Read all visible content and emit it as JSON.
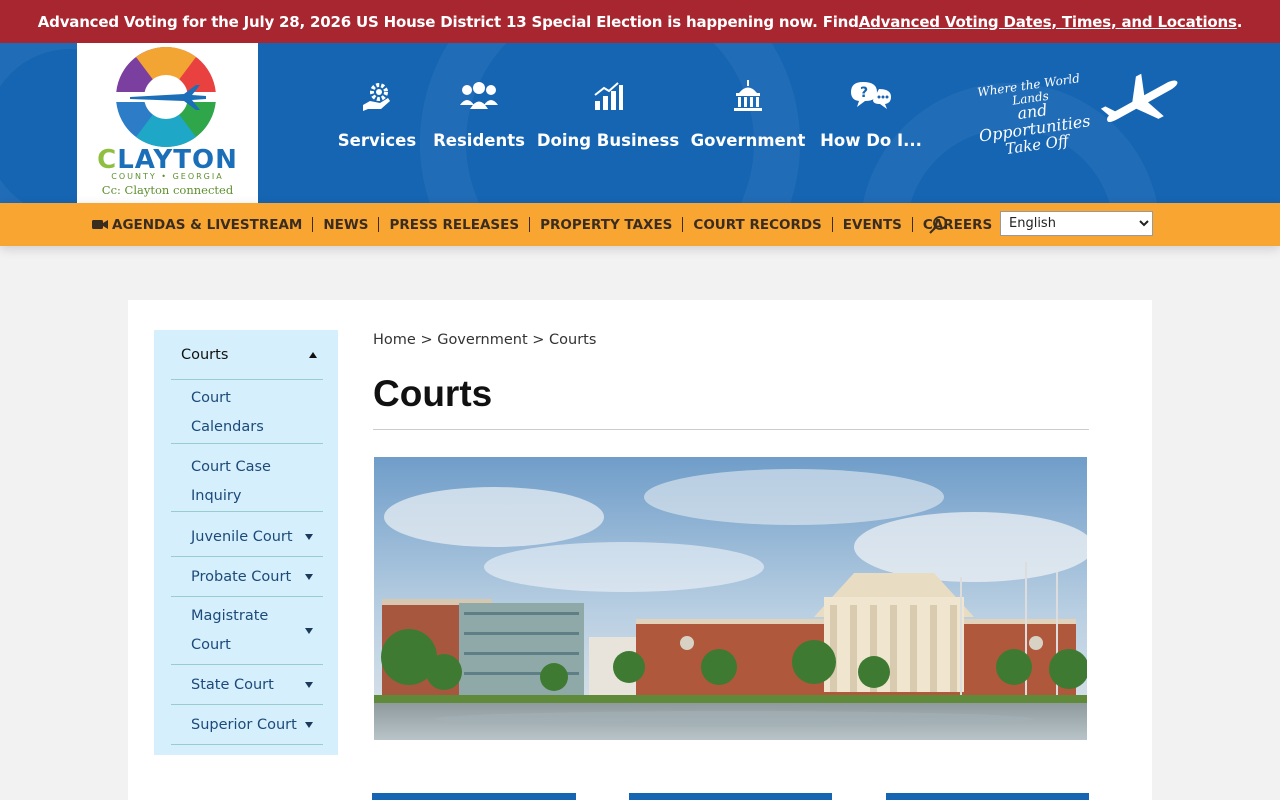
{
  "alert": {
    "text_before": "Advanced Voting for the July 28, 2026 US House District 13 Special Election is happening now. Find ",
    "link_text": "Advanced Voting Dates, Times, and Locations",
    "text_after": ".",
    "background": "#a8262f"
  },
  "logo": {
    "brand_first": "C",
    "brand_rest": "LAYTON",
    "subtitle": "COUNTY • GEORGIA",
    "tagline": "Cc: Clayton connected"
  },
  "main_nav": [
    {
      "label": "Services",
      "icon": "gear-hand-icon"
    },
    {
      "label": "Residents",
      "icon": "people-icon"
    },
    {
      "label": "Doing Business",
      "icon": "growth-chart-icon"
    },
    {
      "label": "Government",
      "icon": "capitol-building-icon"
    },
    {
      "label": "How Do I...",
      "icon": "question-bubble-icon"
    }
  ],
  "slogan": {
    "line1": "Where the World Lands",
    "line2": "and Opportunities",
    "line3": "Take Off"
  },
  "sub_nav": [
    {
      "label": "AGENDAS & LIVESTREAM",
      "icon": "video-camera-icon"
    },
    {
      "label": "NEWS"
    },
    {
      "label": "PRESS RELEASES"
    },
    {
      "label": "PROPERTY TAXES"
    },
    {
      "label": "COURT RECORDS"
    },
    {
      "label": "EVENTS"
    },
    {
      "label": "CAREERS"
    }
  ],
  "language": {
    "selected": "English"
  },
  "sidebar": {
    "heading": "Courts",
    "items": [
      {
        "label": "Court Calendars",
        "has_submenu": false
      },
      {
        "label": "Court Case Inquiry",
        "has_submenu": false
      },
      {
        "label": "Juvenile Court",
        "has_submenu": true
      },
      {
        "label": "Probate Court",
        "has_submenu": true
      },
      {
        "label": "Magistrate Court",
        "has_submenu": true
      },
      {
        "label": "State Court",
        "has_submenu": true
      },
      {
        "label": "Superior Court",
        "has_submenu": true
      }
    ]
  },
  "breadcrumb": {
    "home": "Home",
    "parent": "Government",
    "current": "Courts",
    "separator": ">"
  },
  "page": {
    "title": "Courts"
  },
  "colors": {
    "header_blue": "#1665b3",
    "subnav_orange": "#f9a532",
    "sidebar_bg": "#d6effc",
    "link_blue": "#1c4a7a"
  }
}
